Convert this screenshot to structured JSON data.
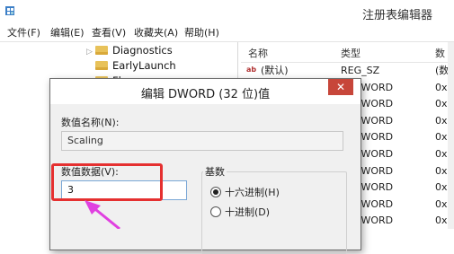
{
  "window": {
    "title": "注册表编辑器"
  },
  "menu": [
    "文件(F)",
    "编辑(E)",
    "查看(V)",
    "收藏夹(A)",
    "帮助(H)"
  ],
  "tree": {
    "items": [
      {
        "label": "Diagnostics"
      },
      {
        "label": "EarlyLaunch"
      },
      {
        "label": "Fla"
      }
    ]
  },
  "list": {
    "headers": {
      "name": "名称",
      "type": "类型",
      "data": "数"
    },
    "rows": [
      {
        "name": "(默认)",
        "type": "REG_SZ",
        "data": "(数"
      },
      {
        "name": "",
        "type": "G_DWORD",
        "data": "0x0"
      },
      {
        "name": "",
        "type": "G_DWORD",
        "data": "0x0"
      },
      {
        "name": "",
        "type": "G_DWORD",
        "data": "0x0"
      },
      {
        "name": "",
        "type": "G_DWORD",
        "data": "0x0"
      },
      {
        "name": "",
        "type": "G_DWORD",
        "data": "0x0"
      },
      {
        "name": "",
        "type": "G_DWORD",
        "data": "0x0"
      },
      {
        "name": "",
        "type": "G_DWORD",
        "data": "0x0"
      },
      {
        "name": "",
        "type": "G_DWORD",
        "data": "0x0"
      },
      {
        "name": "",
        "type": "G_DWORD",
        "data": "0x0"
      }
    ]
  },
  "dialog": {
    "title": "编辑 DWORD (32 位)值",
    "close_label": "✕",
    "value_name_label": "数值名称(N):",
    "value_name": "Scaling",
    "value_data_label": "数值数据(V):",
    "value_data": "3",
    "base_label": "基数",
    "hex_label": "十六进制(H)",
    "dec_label": "十进制(D)",
    "base_selected": "hex"
  },
  "colors": {
    "highlight": "#e53030",
    "arrow": "#e040e0",
    "close_button": "#c7463a"
  }
}
